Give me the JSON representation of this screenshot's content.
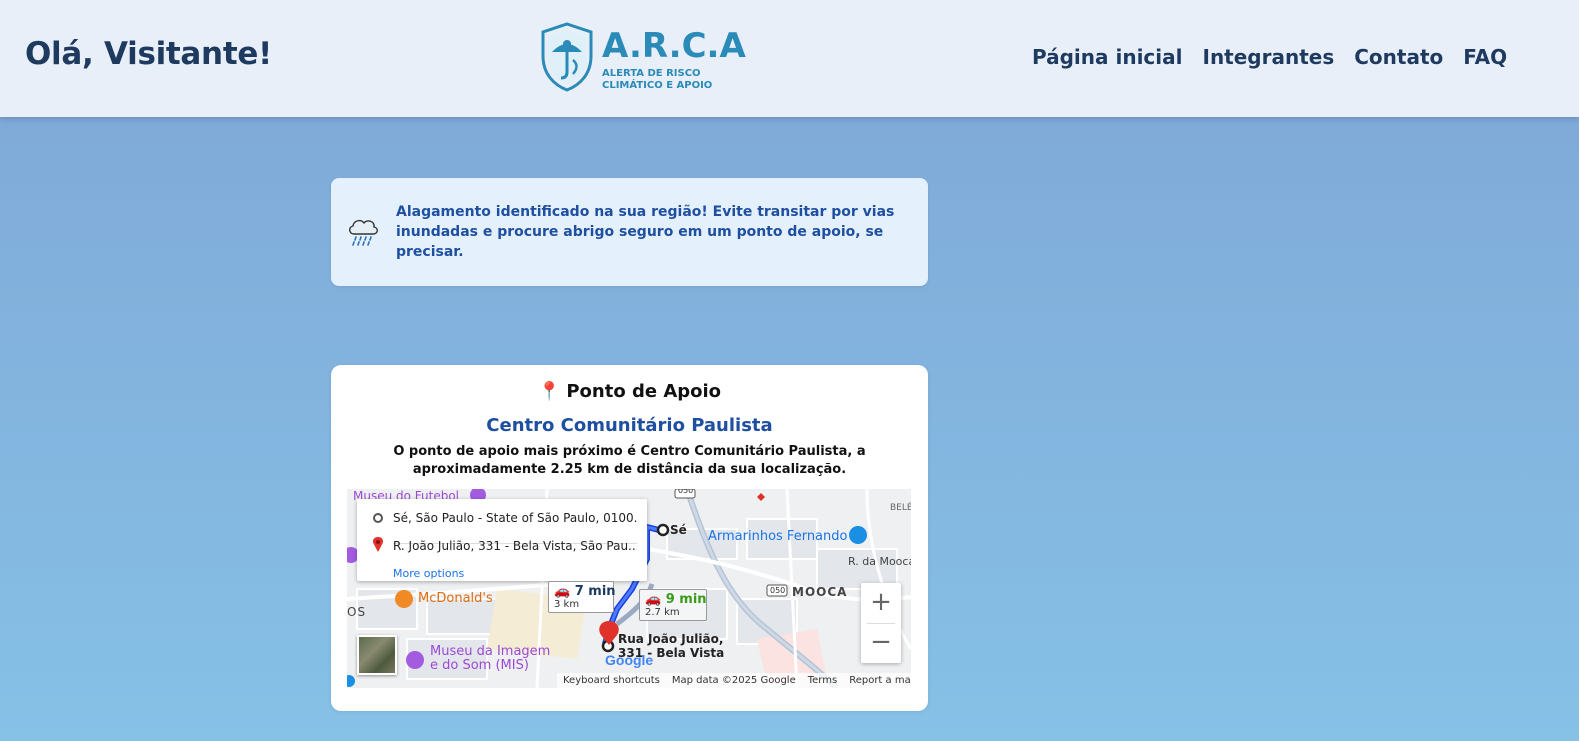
{
  "header": {
    "greeting": "Olá, Visitante!",
    "logo": {
      "name": "A.R.C.A",
      "subtitle_line1": "ALERTA DE RISCO",
      "subtitle_line2": "CLIMÁTICO E APOIO"
    },
    "nav": [
      {
        "label": "Página inicial"
      },
      {
        "label": "Integrantes"
      },
      {
        "label": "Contato"
      },
      {
        "label": "FAQ"
      }
    ]
  },
  "alert": {
    "icon": "rain-cloud-icon",
    "text": "Alagamento identificado na sua região! Evite transitar por vias inundadas e procure abrigo seguro em um ponto de apoio, se precisar."
  },
  "support": {
    "title": "Ponto de Apoio",
    "title_icon": "📍",
    "name": "Centro Comunitário Paulista",
    "description": "O ponto de apoio mais próximo é Centro Comunitário Paulista, a aproximadamente 2.25 km de distância da sua localização."
  },
  "map": {
    "origin": "Sé, São Paulo - State of São Paulo, 0100...",
    "destination": "R. João Julião, 331 - Bela Vista, São Pau...",
    "more_options": "More options",
    "route_primary": {
      "time": "7 min",
      "distance": "3 km"
    },
    "route_alt": {
      "time": "9 min",
      "distance": "2.7 km"
    },
    "places": {
      "museu_futebol": "Museu do Futebol",
      "se": "Sé",
      "armarinhos": "Armarinhos Fernando",
      "rua_mooca": "R. da Mooca",
      "mooca": "MOOCA",
      "belem": "BELÉ",
      "mcdonalds": "McDonald's",
      "os": "OS",
      "museu_imagem_1": "Museu da Imagem",
      "museu_imagem_2": "e do Som (MIS)",
      "dest_label_1": "Rua João Julião,",
      "dest_label_2": "331 - Bela Vista",
      "road_050": "050",
      "road_050b": "050"
    },
    "footer": {
      "keyboard": "Keyboard shortcuts",
      "data": "Map data ©2025 Google",
      "terms": "Terms",
      "report": "Report a map error"
    },
    "google": "Google",
    "zoom_in": "+",
    "zoom_out": "−"
  },
  "colors": {
    "header_bg": "#e8eff9",
    "primary_text": "#1e3a5f",
    "accent_blue": "#1f4fa0",
    "logo_blue": "#2a8ab8",
    "route_blue": "#1a3fdc"
  }
}
